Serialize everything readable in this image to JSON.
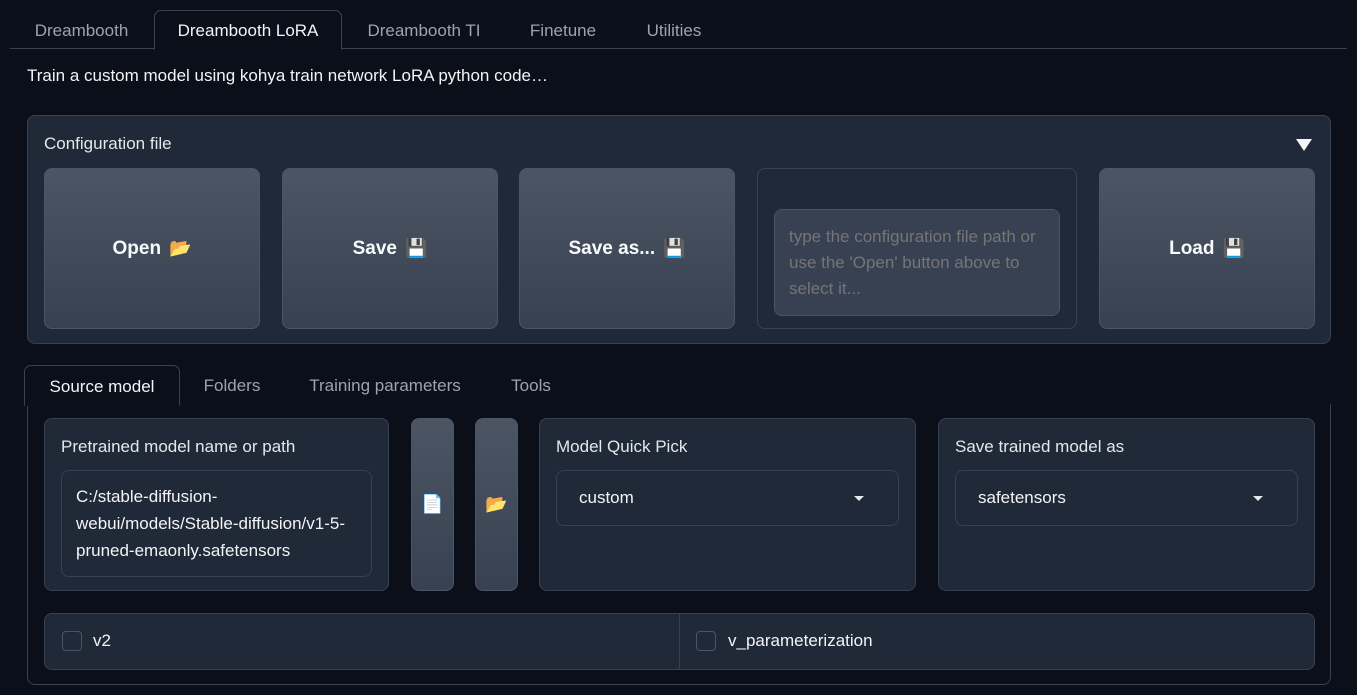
{
  "top_tabs": [
    "Dreambooth",
    "Dreambooth LoRA",
    "Dreambooth TI",
    "Finetune",
    "Utilities"
  ],
  "subtitle": "Train a custom model using kohya train network LoRA python code…",
  "config": {
    "label": "Configuration file",
    "open_label": "Open",
    "open_icon": "📂",
    "save_label": "Save",
    "save_icon": "💾",
    "save_as_label": "Save as...",
    "save_as_icon": "💾",
    "path_placeholder": "type the configuration file path or use the 'Open' button above to select it...",
    "load_label": "Load",
    "load_icon": "💾"
  },
  "sub_tabs": [
    "Source model",
    "Folders",
    "Training parameters",
    "Tools"
  ],
  "source": {
    "pretrained_label": "Pretrained model name or path",
    "pretrained_value": "C:/stable-diffusion-webui/models/Stable-diffusion/v1-5-pruned-emaonly.safetensors",
    "file_icon": "📄",
    "folder_icon": "📂",
    "quick_pick_label": "Model Quick Pick",
    "quick_pick_value": "custom",
    "save_as_label": "Save trained model as",
    "save_as_value": "safetensors",
    "v2_label": "v2",
    "v_param_label": "v_parameterization"
  }
}
